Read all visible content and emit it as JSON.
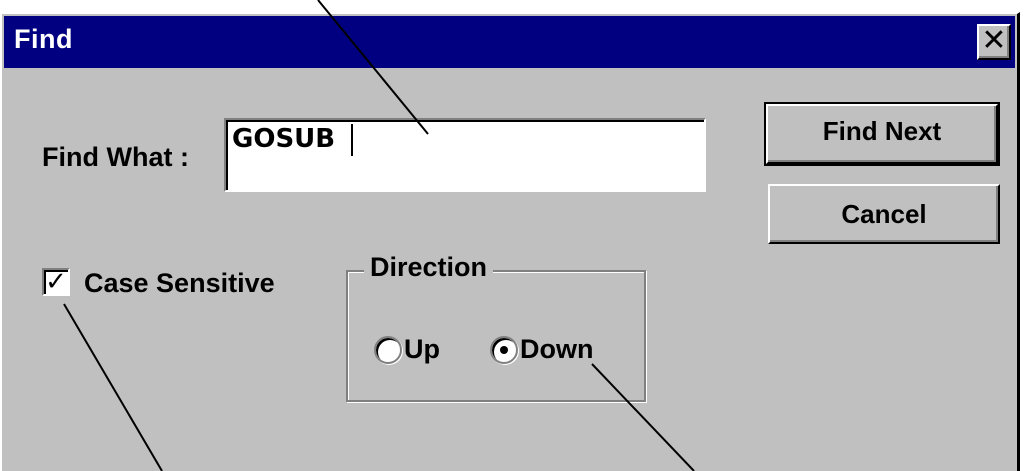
{
  "dialog": {
    "title": "Find",
    "close_label": "✕"
  },
  "form": {
    "find_what_label": "Find What :",
    "find_what_value": "GOSUB",
    "case_sensitive_label": "Case Sensitive",
    "case_sensitive_checked": true,
    "checkbox_mark": "✓"
  },
  "direction": {
    "group_label": "Direction",
    "up_label": "Up",
    "down_label": "Down",
    "selected": "Down"
  },
  "buttons": {
    "find_next_label": "Find Next",
    "cancel_label": "Cancel"
  },
  "colors": {
    "titlebar": "#000080",
    "face": "#c0c0c0"
  }
}
